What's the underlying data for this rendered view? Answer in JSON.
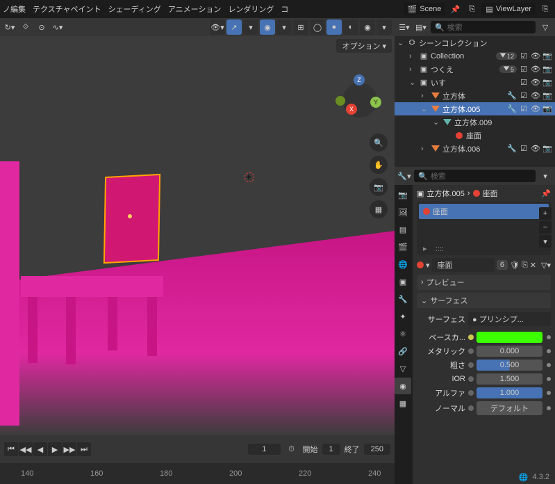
{
  "header": {
    "menus": [
      "ノ編集",
      "テクスチャペイント",
      "シェーディング",
      "アニメーション",
      "レンダリング",
      "コ"
    ],
    "scene_label": "Scene",
    "viewlayer_label": "ViewLayer"
  },
  "viewport": {
    "options_label": "オプション",
    "gizmo": {
      "x": "X",
      "y": "Y",
      "z": "Z"
    },
    "nav_tools": [
      "zoom-icon",
      "pan-icon",
      "camera-icon",
      "perspective-icon"
    ]
  },
  "timeline": {
    "current_frame": "1",
    "start_label": "開始",
    "start_val": "1",
    "end_label": "終了",
    "end_val": "250",
    "ruler_ticks": [
      "140",
      "160",
      "180",
      "200",
      "220",
      "240"
    ]
  },
  "outliner": {
    "search_placeholder": "検索",
    "rows": [
      {
        "indent": 0,
        "icon": "scene-icon",
        "label": "シーンコレクション",
        "toggle": "v"
      },
      {
        "indent": 1,
        "icon": "box-icon",
        "label": "Collection",
        "count": "12",
        "vis": true,
        "toggle": ">"
      },
      {
        "indent": 1,
        "icon": "box-icon",
        "label": "つくえ",
        "count": "5",
        "vis": true,
        "toggle": ">"
      },
      {
        "indent": 1,
        "icon": "box-icon",
        "label": "いす",
        "vis": true,
        "toggle": "v"
      },
      {
        "indent": 2,
        "icon": "tri",
        "label": "立方体",
        "vis": true,
        "toggle": ">",
        "mod": true
      },
      {
        "indent": 2,
        "icon": "tri",
        "label": "立方体.005",
        "vis": true,
        "toggle": "v",
        "active": true,
        "mod": true,
        "selected": true
      },
      {
        "indent": 3,
        "icon": "tri-teal",
        "label": "立方体.009",
        "toggle": "v"
      },
      {
        "indent": 4,
        "icon": "mat",
        "label": "座面"
      },
      {
        "indent": 2,
        "icon": "tri",
        "label": "立方体.006",
        "vis": true,
        "toggle": ">",
        "mod": true
      }
    ]
  },
  "properties": {
    "search_placeholder": "検索",
    "breadcrumb": {
      "obj": "立方体.005",
      "mat": "座面"
    },
    "material_slot": "座面",
    "material_name": "座面",
    "material_users": "6",
    "panels": {
      "preview": "プレビュー",
      "surface": "サーフェス"
    },
    "surface_label": "サーフェス",
    "surface_value": "● プリンシプ...",
    "params": [
      {
        "label": "ベースカ...",
        "type": "color",
        "value": "#3cff00",
        "dot": "#ccc850"
      },
      {
        "label": "メタリック",
        "type": "num",
        "value": "0.000",
        "fill": "none"
      },
      {
        "label": "粗さ",
        "type": "num",
        "value": "0.500",
        "fill": "half"
      },
      {
        "label": "IOR",
        "type": "num",
        "value": "1.500",
        "fill": "none"
      },
      {
        "label": "アルファ",
        "type": "num",
        "value": "1.000",
        "fill": "full"
      },
      {
        "label": "ノーマル",
        "type": "text",
        "value": "デフォルト"
      }
    ]
  },
  "status": {
    "version": "4.3.2"
  }
}
